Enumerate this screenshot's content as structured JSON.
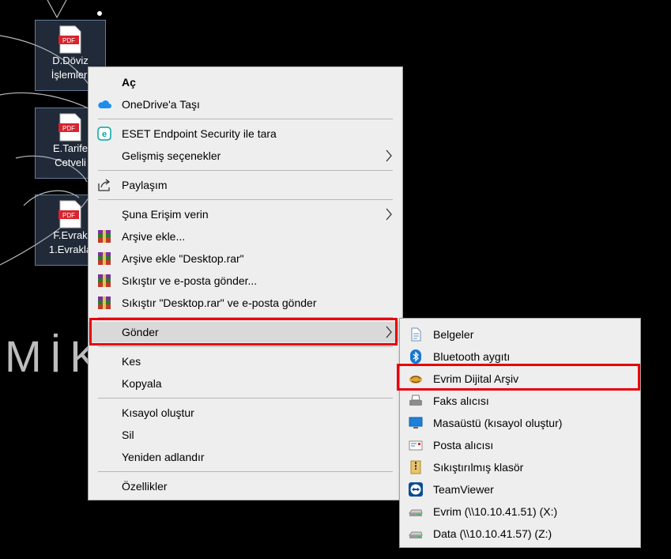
{
  "desktop": {
    "watermark": "MİK",
    "icons": [
      {
        "line1": "D.Döviz",
        "line2": "İşlemleri",
        "badge": "PDF"
      },
      {
        "line1": "E.Tarife",
        "line2": "Cetveli",
        "badge": "PDF"
      },
      {
        "line1": "F.Evrak",
        "line2": "1.Evrakla",
        "badge": "PDF"
      }
    ]
  },
  "context_menu": {
    "open": "Aç",
    "onedrive": "OneDrive'a Taşı",
    "eset": "ESET Endpoint Security ile tara",
    "advanced": "Gelişmiş seçenekler",
    "share": "Paylaşım",
    "give_access": "Şuna Erişim verin",
    "add_archive": "Arşive ekle...",
    "add_desktop_rar": "Arşive ekle \"Desktop.rar\"",
    "compress_email": "Sıkıştır ve e-posta gönder...",
    "compress_desktop_email": "Sıkıştır \"Desktop.rar\" ve e-posta gönder",
    "send_to": "Gönder",
    "cut": "Kes",
    "copy": "Kopyala",
    "create_shortcut": "Kısayol oluştur",
    "delete": "Sil",
    "rename": "Yeniden adlandır",
    "properties": "Özellikler"
  },
  "send_to_menu": {
    "documents": "Belgeler",
    "bluetooth": "Bluetooth aygıtı",
    "evrim": "Evrim Dijital Arşiv",
    "fax": "Faks alıcısı",
    "desktop_shortcut": "Masaüstü (kısayol oluştur)",
    "mail": "Posta alıcısı",
    "zip": "Sıkıştırılmış klasör",
    "teamviewer": "TeamViewer",
    "drive_x": "Evrim (\\\\10.10.41.51) (X:)",
    "drive_z": "Data (\\\\10.10.41.57) (Z:)"
  },
  "colors": {
    "highlight": "#e8000b",
    "menu_bg": "#eeeeee",
    "pdf_red": "#d9232e"
  },
  "icons": {
    "onedrive": "cloud-icon",
    "eset": "eset-icon",
    "share": "share-icon",
    "winrar": "winrar-icon",
    "documents": "document-icon",
    "bluetooth": "bluetooth-icon",
    "evrim": "archive-icon",
    "fax": "fax-icon",
    "desktop": "desktop-icon",
    "mail": "mail-icon",
    "zip": "zip-folder-icon",
    "teamviewer": "teamviewer-icon",
    "drive": "network-drive-icon"
  }
}
